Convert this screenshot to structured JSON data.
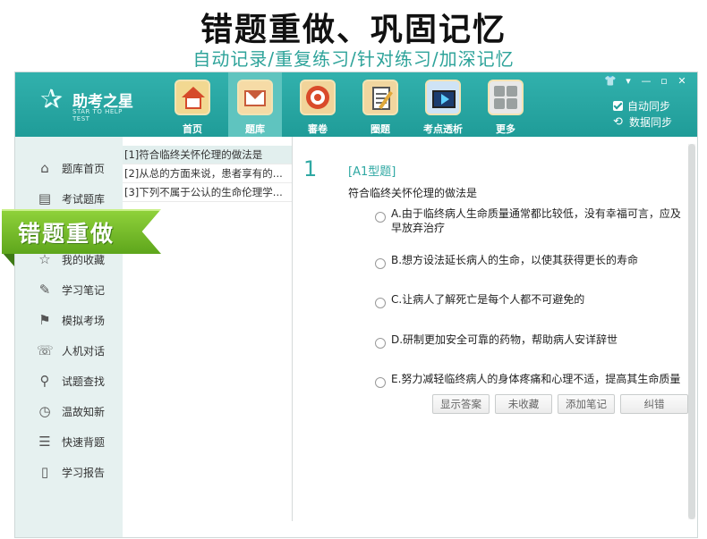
{
  "banner": {
    "title": "错题重做、巩固记忆",
    "subtitle": "自动记录/重复练习/针对练习/加深记忆"
  },
  "app": {
    "logo_name": "助考之星",
    "logo_en": "STAR TO HELP TEST"
  },
  "nav": {
    "items": [
      {
        "label": "首页",
        "icon": "home-icon"
      },
      {
        "label": "题库",
        "icon": "mail-icon"
      },
      {
        "label": "審卷",
        "icon": "target-icon"
      },
      {
        "label": "圈题",
        "icon": "clipboard-icon"
      },
      {
        "label": "考点透析",
        "icon": "video-icon"
      },
      {
        "label": "更多",
        "icon": "grid-icon"
      }
    ],
    "active_index": 1
  },
  "window_controls": [
    "👕",
    "▾",
    "—",
    "▫",
    "✕"
  ],
  "sync": {
    "auto_sync_label": "自动同步",
    "data_sync_label": "数据同步"
  },
  "sidebar": {
    "items": [
      {
        "label": "题库首页",
        "icon": "home-outline-icon"
      },
      {
        "label": "考试题库",
        "icon": "document-icon"
      },
      {
        "label": "我的收藏",
        "icon": "star-icon"
      },
      {
        "label": "学习笔记",
        "icon": "edit-icon"
      },
      {
        "label": "模拟考场",
        "icon": "graduation-cap-icon"
      },
      {
        "label": "人机对话",
        "icon": "chat-icon"
      },
      {
        "label": "试题查找",
        "icon": "search-icon"
      },
      {
        "label": "温故知新",
        "icon": "clock-icon"
      },
      {
        "label": "快速背题",
        "icon": "list-icon"
      },
      {
        "label": "学习报告",
        "icon": "book-icon"
      }
    ]
  },
  "ribbon": {
    "label": "错题重做"
  },
  "question_list": [
    "[1]符合临终关怀伦理的做法是",
    "[2]从总的方面来说，患者享有的...",
    "[3]下列不属于公认的生命伦理学..."
  ],
  "question": {
    "number": "1",
    "type": "[A1型题]",
    "stem": "符合临终关怀伦理的做法是",
    "options": [
      "A.由于临终病人生命质量通常都比较低，没有幸福可言，应及早放弃治疗",
      "B.想方设法延长病人的生命，以使其获得更长的寿命",
      "C.让病人了解死亡是每个人都不可避免的",
      "D.研制更加安全可靠的药物，帮助病人安详辞世",
      "E.努力减轻临终病人的身体疼痛和心理不适，提高其生命质量"
    ]
  },
  "actions": {
    "show_answer": "显示答案",
    "favorite": "未收藏",
    "add_note": "添加笔记",
    "report_error": "纠错"
  }
}
